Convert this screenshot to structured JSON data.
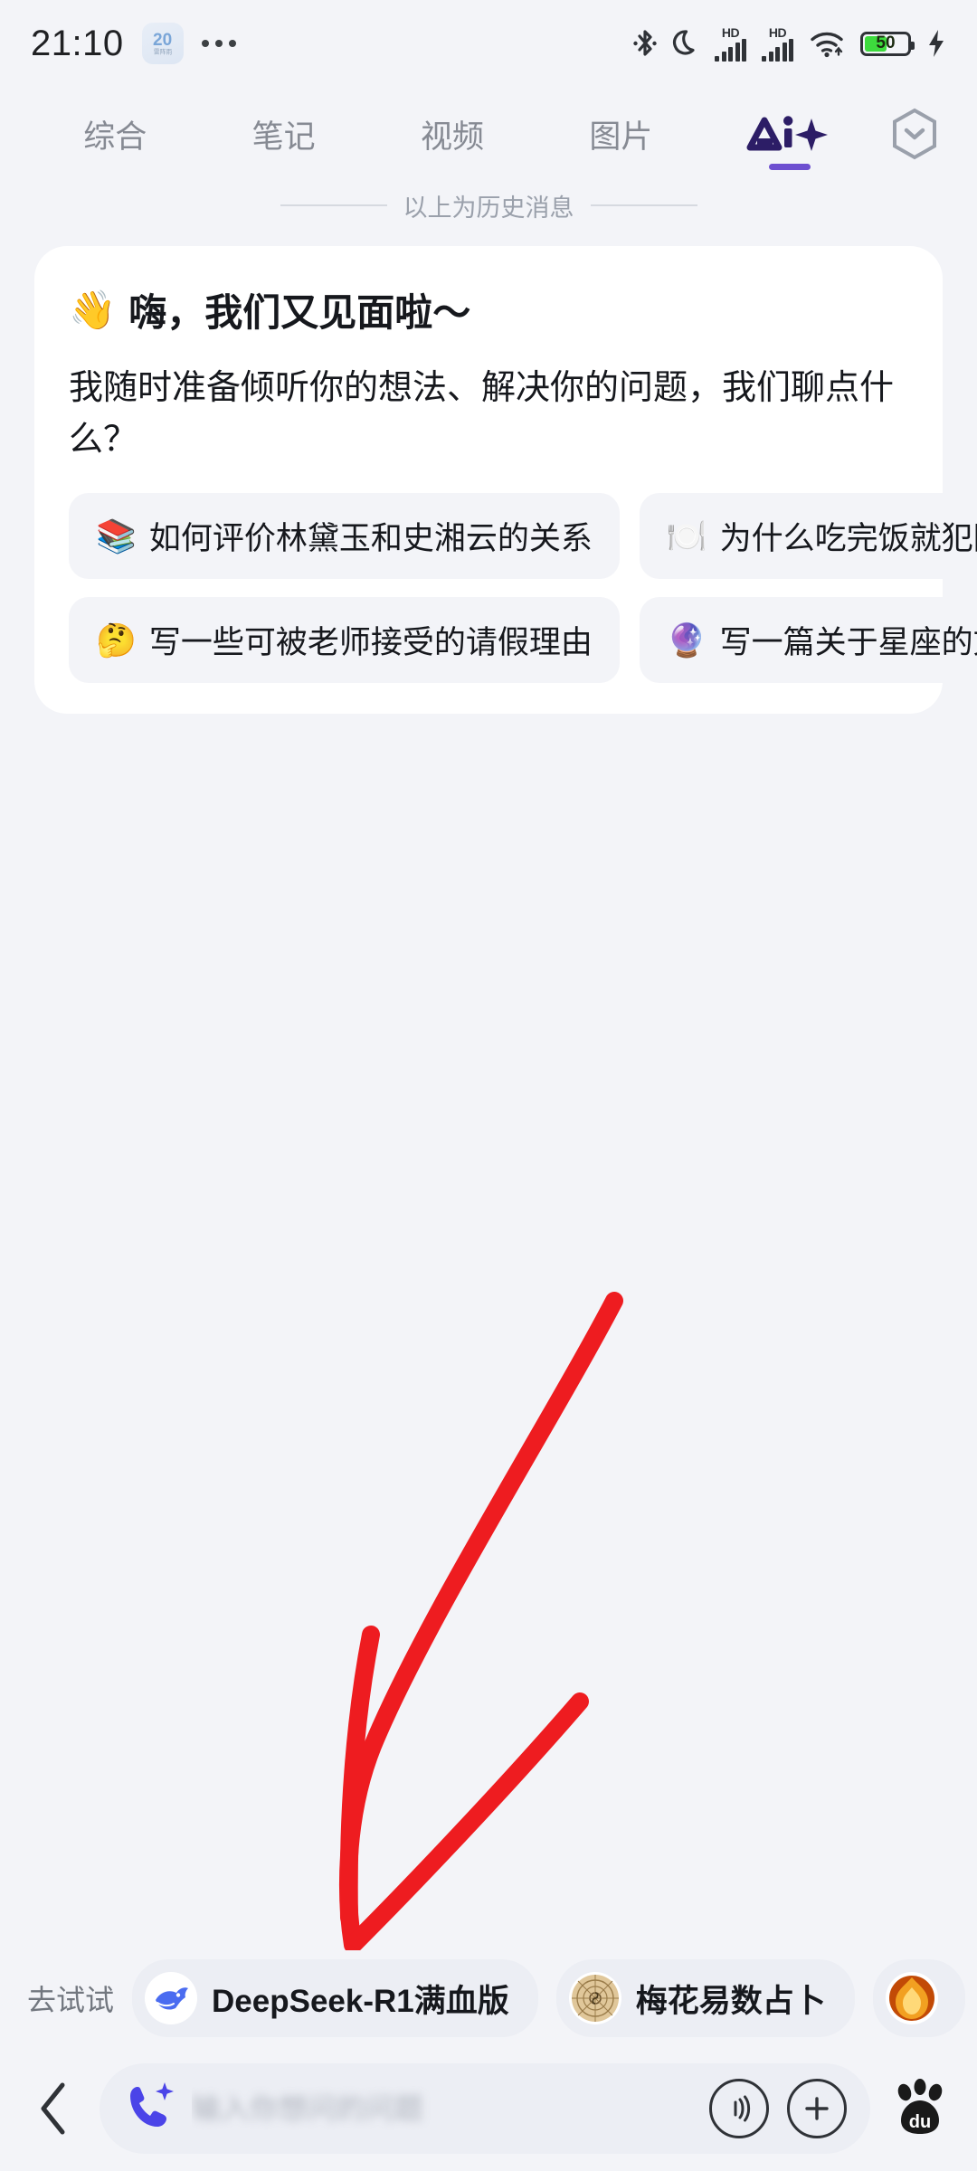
{
  "status_bar": {
    "time": "21:10",
    "weather_badge": {
      "temp": "20",
      "label": "雷阵雨"
    },
    "icons": [
      "bluetooth-icon",
      "do-not-disturb-moon-icon",
      "hd-signal-icon",
      "hd-signal-icon",
      "wifi-icon",
      "battery-icon",
      "charging-bolt-icon"
    ],
    "battery_percent": "50",
    "hd_label": "HD",
    "battery_fill_color": "#3ddb3d"
  },
  "tabs": {
    "items": [
      {
        "label": "综合",
        "active": false
      },
      {
        "label": "笔记",
        "active": false
      },
      {
        "label": "视频",
        "active": false
      },
      {
        "label": "图片",
        "active": false
      },
      {
        "label": "Ai",
        "active": true
      }
    ],
    "ai_tab_label": "Ai",
    "accent_color": "#6d4fd0",
    "right_icon": "chevron-down-hexagon-icon"
  },
  "history_divider": {
    "text": "以上为历史消息"
  },
  "ai_card": {
    "greeting_emoji": "👋",
    "greeting": "嗨，我们又见面啦～",
    "intro": "我随时准备倾听你的想法、解决你的问题，我们聊点什么？",
    "suggestion_rows": [
      [
        {
          "emoji": "📚",
          "text": "如何评价林黛玉和史湘云的关系"
        },
        {
          "emoji": "🍽️",
          "text": "为什么吃完饭就犯困"
        }
      ],
      [
        {
          "emoji": "🤔",
          "text": "写一些可被老师接受的请假理由"
        },
        {
          "emoji": "🔮",
          "text": "写一篇关于星座的文章"
        }
      ]
    ]
  },
  "annotation": {
    "type": "hand-drawn-red-arrow",
    "color": "#ee1c20",
    "points_to": "deepseek-model-chip"
  },
  "try_bar": {
    "label": "去试试",
    "chips": [
      {
        "text": "DeepSeek-R1满血版",
        "icon": "deepseek-whale-icon"
      },
      {
        "text": "梅花易数占卜",
        "icon": "bagua-compass-icon"
      },
      {
        "text": "",
        "icon": "fire-orb-icon"
      }
    ]
  },
  "input_bar": {
    "back_icon": "chevron-left-icon",
    "ai_call_icon": "ai-phone-sparkle-icon",
    "placeholder": "输入你想问的问题",
    "voice_icon": "voice-wave-icon",
    "plus_icon": "plus-icon",
    "brand_icon": "baidu-paw-icon",
    "accent_color": "#4b44e8"
  }
}
